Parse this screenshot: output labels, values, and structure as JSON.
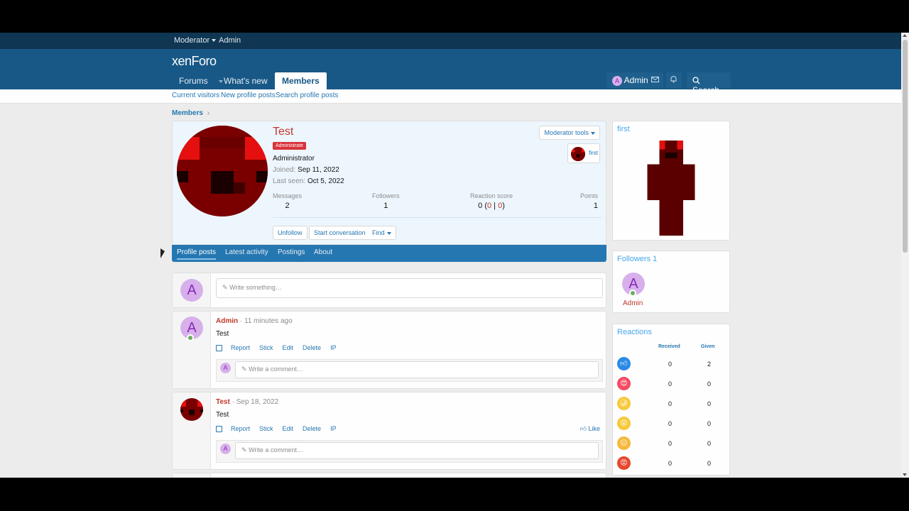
{
  "staff_bar": {
    "moderator": "Moderator",
    "admin": "Admin"
  },
  "header": {
    "logo_a": "xen",
    "logo_b": "Foro"
  },
  "nav": {
    "forums": "Forums",
    "whats_new": "What's new",
    "members": "Members",
    "user": "Admin",
    "user_initial": "A",
    "search": "Search"
  },
  "subnav": {
    "current_visitors": "Current visitors",
    "new_profile_posts": "New profile posts",
    "search_profile_posts": "Search profile posts"
  },
  "breadcrumb": "Members",
  "profile": {
    "name": "Test",
    "badge": "Administrate",
    "title": "Administrator",
    "joined_label": "Joined:",
    "joined": "Sep 11, 2022",
    "seen_label": "Last seen:",
    "seen": "Oct 5, 2022",
    "moderator_tools": "Moderator tools",
    "trophy": "first",
    "stats": {
      "messages_label": "Messages",
      "messages": "2",
      "followers_label": "Followers",
      "followers": "1",
      "reaction_label": "Reaction score",
      "reaction_a": "0 (",
      "reaction_b": "0",
      "reaction_sep": " | ",
      "reaction_c": "0",
      "reaction_d": ")",
      "points_label": "Points",
      "points": "1"
    },
    "buttons": {
      "unfollow": "Unfollow",
      "start_conversation": "Start conversation",
      "find": "Find"
    }
  },
  "tabs": {
    "profile_posts": "Profile posts",
    "latest_activity": "Latest activity",
    "postings": "Postings",
    "about": "About"
  },
  "compose": {
    "avatar": "A",
    "placeholder": "Write something…"
  },
  "posts": [
    {
      "author": "Admin",
      "time": "· 11 minutes ago",
      "text": "Test",
      "avatar": "A"
    },
    {
      "author": "Test",
      "time": "· Sep 18, 2022",
      "text": "Test",
      "like": "Like"
    }
  ],
  "post_actions": {
    "report": "Report",
    "stick": "Stick",
    "edit": "Edit",
    "delete": "Delete",
    "ip": "IP"
  },
  "comment": {
    "avatar": "A",
    "placeholder": "Write a comment…"
  },
  "sidebar": {
    "trophy_title": "first",
    "followers_title": "Followers 1",
    "follower_initial": "A",
    "follower_name": "Admin",
    "reactions_title": "Reactions",
    "received": "Received",
    "given": "Given",
    "rows": [
      {
        "icon": "like-icon",
        "received": "0",
        "given": "2",
        "color": "#2b8ae6"
      },
      {
        "icon": "love-icon",
        "received": "0",
        "given": "0",
        "color": "#f44c63"
      },
      {
        "icon": "haha-icon",
        "received": "0",
        "given": "0",
        "color": "#f7c83b"
      },
      {
        "icon": "wow-icon",
        "received": "0",
        "given": "0",
        "color": "#f7c83b"
      },
      {
        "icon": "sad-icon",
        "received": "0",
        "given": "0",
        "color": "#f7b83b"
      },
      {
        "icon": "angry-icon",
        "received": "0",
        "given": "0",
        "color": "#e8472f"
      }
    ]
  },
  "colors": {
    "brand": "#185886",
    "staff_bar": "#0f3652",
    "tab_bar": "#2577b1",
    "link": "#2577b1",
    "name": "#c0392b"
  }
}
